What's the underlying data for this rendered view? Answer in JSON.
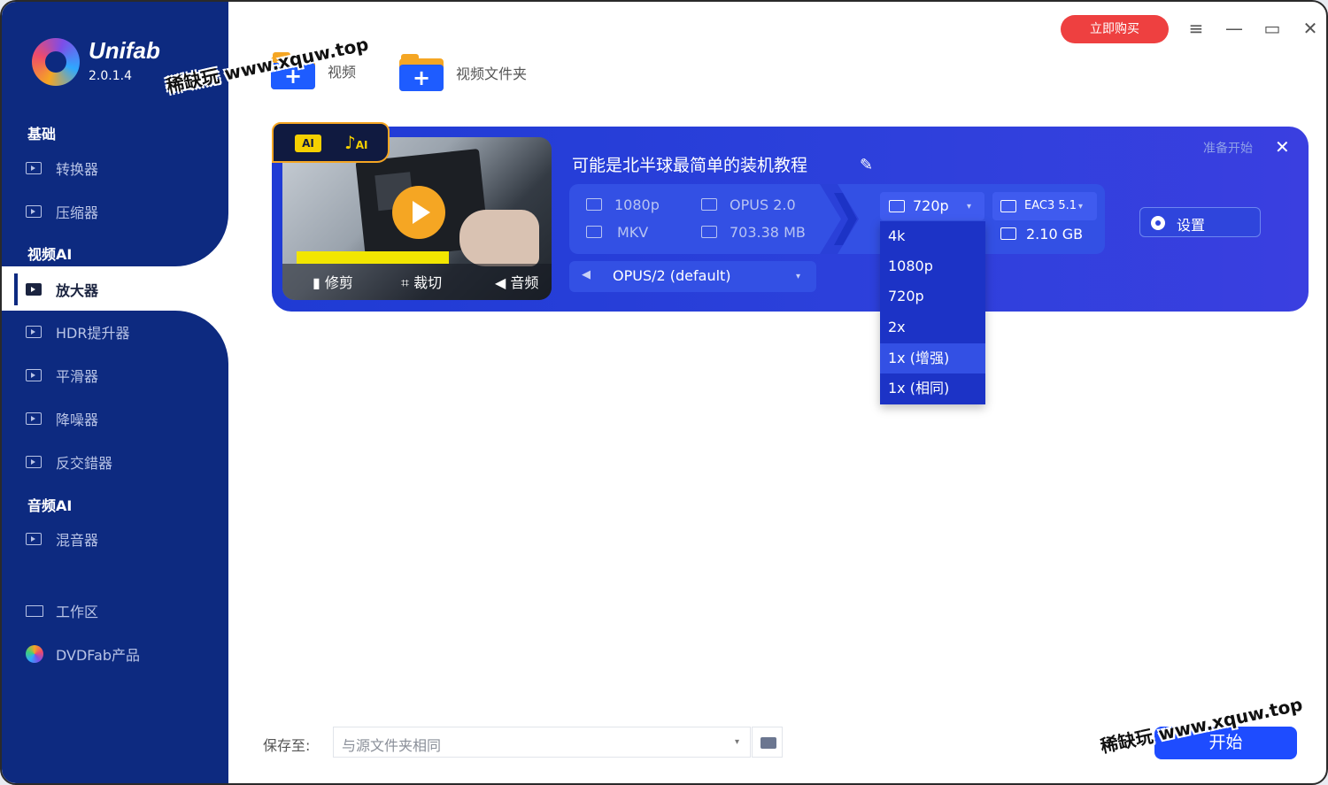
{
  "app": {
    "name": "Unifab",
    "version": "2.0.1.4"
  },
  "sidebar": {
    "sections": [
      {
        "title": "基础"
      },
      {
        "title": "视频AI"
      },
      {
        "title": "音频AI"
      }
    ],
    "items": [
      {
        "label": "转换器"
      },
      {
        "label": "压缩器"
      },
      {
        "label": "放大器"
      },
      {
        "label": "HDR提升器"
      },
      {
        "label": "平滑器"
      },
      {
        "label": "降噪器"
      },
      {
        "label": "反交錯器"
      },
      {
        "label": "混音器"
      },
      {
        "label": "工作区"
      },
      {
        "label": "DVDFab产品"
      }
    ]
  },
  "topbar": {
    "add_video": "视频",
    "add_folder": "视频文件夹",
    "buy": "立即购买"
  },
  "task": {
    "title": "可能是北半球最简单的装机教程",
    "status": "准备开始",
    "thumb_tools": [
      "修剪",
      "裁切",
      "音频"
    ],
    "thumb_badge": [
      "AI",
      "AI"
    ],
    "source": {
      "resolution": "1080p",
      "audio": "OPUS 2.0",
      "container": "MKV",
      "size": "703.38 MB"
    },
    "target": {
      "resolution": "720p",
      "audio": "EAC3 5.1",
      "size": "2.10 GB"
    },
    "audio_track": "OPUS/2 (default)",
    "settings": "设置"
  },
  "dropdown": {
    "options": [
      "4k",
      "1080p",
      "720p",
      "2x",
      "1x (增强)",
      "1x (相同)"
    ],
    "highlighted": "1x (增强)"
  },
  "footer": {
    "save_label": "保存至:",
    "save_value": "与源文件夹相同",
    "start": "开始"
  },
  "watermarks": [
    "稀缺玩 www.xquw.top",
    "稀缺玩 www.xquw.top"
  ],
  "colors": {
    "sidebar": "#0d2a80",
    "card": "#2c40db",
    "buy": "#ee4040",
    "start": "#1e4cff",
    "accent": "#f5a623"
  }
}
